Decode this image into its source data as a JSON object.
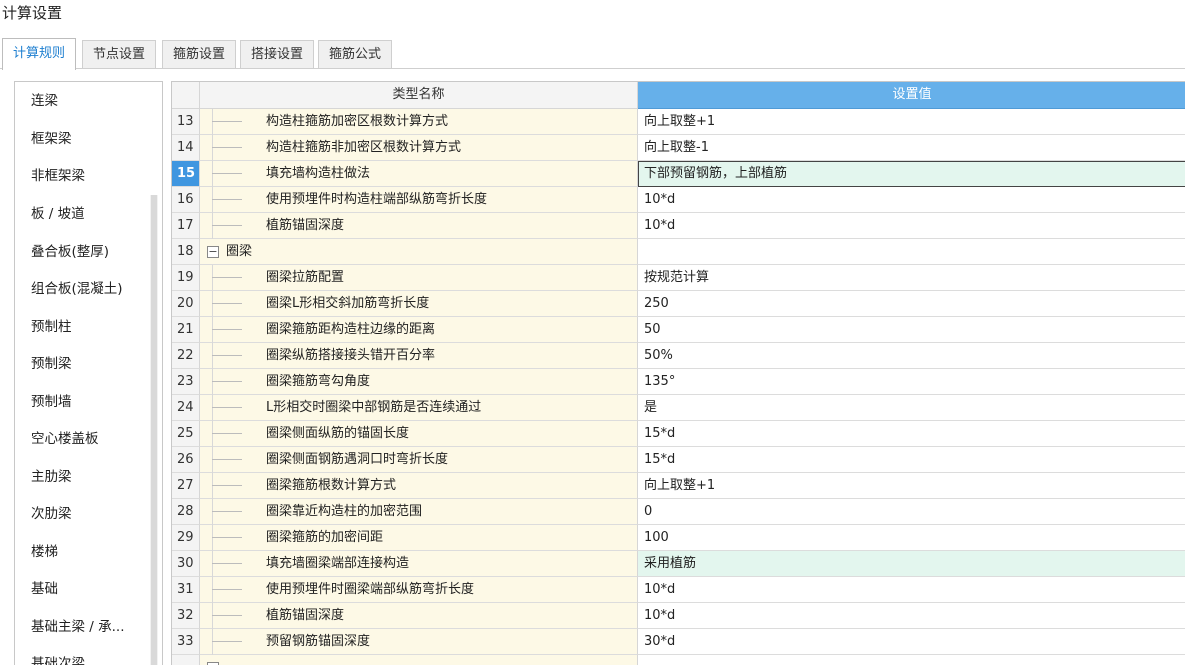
{
  "window": {
    "title": "计算设置"
  },
  "tabs": [
    {
      "label": "计算规则",
      "active": true
    },
    {
      "label": "节点设置",
      "active": false
    },
    {
      "label": "箍筋设置",
      "active": false
    },
    {
      "label": "搭接设置",
      "active": false
    },
    {
      "label": "箍筋公式",
      "active": false
    }
  ],
  "sidebar": {
    "items": [
      "连梁",
      "框架梁",
      "非框架梁",
      "板 / 坡道",
      "叠合板(整厚)",
      "组合板(混凝土)",
      "预制柱",
      "预制梁",
      "预制墙",
      "空心楼盖板",
      "主肋梁",
      "次肋梁",
      "楼梯",
      "基础",
      "基础主梁 / 承...",
      "基础次梁"
    ]
  },
  "grid": {
    "header": {
      "name": "类型名称",
      "value": "设置值"
    },
    "rows": [
      {
        "num": "13",
        "name": "构造柱箍筋加密区根数计算方式",
        "value": "向上取整+1"
      },
      {
        "num": "14",
        "name": "构造柱箍筋非加密区根数计算方式",
        "value": "向上取整-1"
      },
      {
        "num": "15",
        "name": "填充墙构造柱做法",
        "value": "下部预留钢筋，上部植筋"
      },
      {
        "num": "16",
        "name": "使用预埋件时构造柱端部纵筋弯折长度",
        "value": "10*d"
      },
      {
        "num": "17",
        "name": "植筋锚固深度",
        "value": "10*d"
      },
      {
        "num": "18",
        "name": "圈梁",
        "value": ""
      },
      {
        "num": "19",
        "name": "圈梁拉筋配置",
        "value": "按规范计算"
      },
      {
        "num": "20",
        "name": "圈梁L形相交斜加筋弯折长度",
        "value": "250"
      },
      {
        "num": "21",
        "name": "圈梁箍筋距构造柱边缘的距离",
        "value": "50"
      },
      {
        "num": "22",
        "name": "圈梁纵筋搭接接头错开百分率",
        "value": "50%"
      },
      {
        "num": "23",
        "name": "圈梁箍筋弯勾角度",
        "value": "135°"
      },
      {
        "num": "24",
        "name": "L形相交时圈梁中部钢筋是否连续通过",
        "value": "是"
      },
      {
        "num": "25",
        "name": "圈梁侧面纵筋的锚固长度",
        "value": "15*d"
      },
      {
        "num": "26",
        "name": "圈梁侧面钢筋遇洞口时弯折长度",
        "value": "15*d"
      },
      {
        "num": "27",
        "name": "圈梁箍筋根数计算方式",
        "value": "向上取整+1"
      },
      {
        "num": "28",
        "name": "圈梁靠近构造柱的加密范围",
        "value": "0"
      },
      {
        "num": "29",
        "name": "圈梁箍筋的加密间距",
        "value": "100"
      },
      {
        "num": "30",
        "name": "填充墙圈梁端部连接构造",
        "value": "采用植筋"
      },
      {
        "num": "31",
        "name": "使用预埋件时圈梁端部纵筋弯折长度",
        "value": "10*d"
      },
      {
        "num": "32",
        "name": "植筋锚固深度",
        "value": "10*d"
      },
      {
        "num": "33",
        "name": "预留钢筋锚固深度",
        "value": "30*d"
      }
    ]
  }
}
